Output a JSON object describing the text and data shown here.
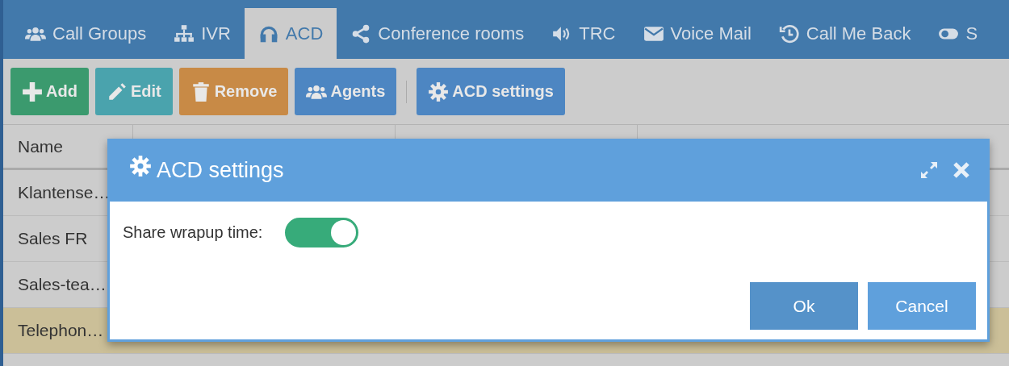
{
  "tabs": [
    {
      "label": "Call Groups",
      "kind": "group",
      "selected": false
    },
    {
      "label": "IVR",
      "kind": "sitemap",
      "selected": false
    },
    {
      "label": "ACD",
      "kind": "headset",
      "selected": true
    },
    {
      "label": "Conference rooms",
      "kind": "share",
      "selected": false
    },
    {
      "label": "TRC",
      "kind": "speaker",
      "selected": false
    },
    {
      "label": "Voice Mail",
      "kind": "mail",
      "selected": false
    },
    {
      "label": "Call Me Back",
      "kind": "history",
      "selected": false
    },
    {
      "label": "S",
      "kind": "toggle",
      "selected": false
    }
  ],
  "toolbar": [
    {
      "label": "Add",
      "kind": "plus",
      "color": "#3b9a6e"
    },
    {
      "label": "Edit",
      "kind": "pencil",
      "color": "#4aa3ad"
    },
    {
      "label": "Remove",
      "kind": "trash",
      "color": "#c88a46"
    },
    {
      "label": "Agents",
      "kind": "group",
      "color": "#4d86c2"
    },
    {
      "label": "ACD settings",
      "kind": "gear",
      "color": "#4d86c2"
    }
  ],
  "table": {
    "columns": [
      "Name"
    ],
    "rows": [
      {
        "name": "Klantense…",
        "selected": false
      },
      {
        "name": "Sales FR",
        "selected": false
      },
      {
        "name": "Sales-tea…",
        "selected": false
      },
      {
        "name": "Telephon…",
        "selected": true
      }
    ]
  },
  "dialog": {
    "title": "ACD settings",
    "fields": [
      {
        "label": "Share wrapup time:",
        "on": true
      }
    ],
    "buttons": [
      {
        "label": "Ok",
        "kind": "primary"
      },
      {
        "label": "Cancel",
        "kind": "secondary"
      }
    ]
  }
}
